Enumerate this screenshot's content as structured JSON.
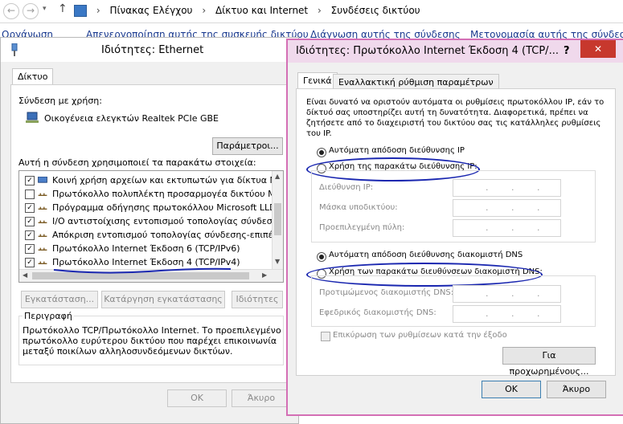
{
  "explorer": {
    "breadcrumb": [
      "Πίνακας Ελέγχου",
      "Δίκτυο και Internet",
      "Συνδέσεις δικτύου"
    ],
    "commands": [
      "Οργάνωση",
      "Απενεργοποίηση αυτής της συσκευής δικτύου",
      "Διάγνωση αυτής της σύνδεσης",
      "Μετονομασία αυτής της σύνδεσης"
    ]
  },
  "ethernet_dialog": {
    "title": "Ιδιότητες: Ethernet",
    "tab": "Δίκτυο",
    "connect_using_label": "Σύνδεση με χρήση:",
    "adapter_name": "Οικογένεια ελεγκτών Realtek PCIe GBE",
    "configure_button": "Παράμετροι...",
    "items_label": "Αυτή η σύνδεση χρησιμοποιεί τα παρακάτω στοιχεία:",
    "items": [
      {
        "label": "Κοινή χρήση αρχείων και εκτυπωτών για δίκτυα Micro",
        "checked": true
      },
      {
        "label": "Πρωτόκολλο πολυπλέκτη προσαρμογέα δικτύου Micros",
        "checked": false
      },
      {
        "label": "Πρόγραμμα οδήγησης πρωτοκόλλου Microsoft LLDP",
        "checked": true
      },
      {
        "label": "I/O αντιστοίχισης εντοπισμού τοπολογίας σύνδεσης-",
        "checked": true
      },
      {
        "label": "Απόκριση εντοπισμού τοπολογίας σύνδεσης-επιπέδου",
        "checked": true
      },
      {
        "label": "Πρωτόκολλο Internet Έκδοση 6 (TCP/IPv6)",
        "checked": true
      },
      {
        "label": "Πρωτόκολλο Internet Έκδοση 4 (TCP/IPv4)",
        "checked": true
      }
    ],
    "install_button": "Εγκατάσταση...",
    "uninstall_button": "Κατάργηση εγκατάστασης",
    "properties_button": "Ιδιότητες",
    "description_label": "Περιγραφή",
    "description_text": [
      "Πρωτόκολλο TCP/Πρωτόκολλο Internet. Το προεπιλεγμένο",
      "πρωτόκολλο ευρύτερου δικτύου που παρέχει επικοινωνία",
      "μεταξύ ποικίλων αλληλοσυνδεόμενων δικτύων."
    ],
    "ok_button": "ΟΚ",
    "cancel_button": "Άκυρο"
  },
  "ipv4_dialog": {
    "title": "Ιδιότητες: Πρωτόκολλο Internet Έκδοση 4 (TCP/...",
    "help_glyph": "?",
    "close_glyph": "✕",
    "tabs": [
      "Γενικά",
      "Εναλλακτική ρύθμιση παραμέτρων"
    ],
    "intro_text": [
      "Είναι δυνατό να οριστούν αυτόματα οι ρυθμίσεις πρωτοκόλλου IP, εάν το",
      "δίκτυό σας υποστηρίζει αυτή τη δυνατότητα. Διαφορετικά, πρέπει να",
      "ζητήσετε από το διαχειριστή του δικτύου σας τις κατάλληλες ρυθμίσεις",
      "του IP."
    ],
    "auto_ip_label": "Αυτόματη απόδοση διεύθυνσης IP",
    "manual_ip_label": "Χρήση της παρακάτω διεύθυνσης IP:",
    "ip_address_label": "Διεύθυνση IP:",
    "subnet_mask_label": "Μάσκα υποδικτύου:",
    "gateway_label": "Προεπιλεγμένη πύλη:",
    "auto_dns_label": "Αυτόματη απόδοση διεύθυνσης διακομιστή DNS",
    "manual_dns_label": "Χρήση των παρακάτω διευθύνσεων διακομιστή DNS:",
    "preferred_dns_label": "Προτιμώμενος διακομιστής DNS:",
    "alternate_dns_label": "Εφεδρικός διακομιστής DNS:",
    "validate_label": "Επικύρωση των ρυθμίσεων κατά την έξοδο",
    "advanced_button": "Για προχωρημένους...",
    "ok_button": "ΟΚ",
    "cancel_button": "Άκυρο",
    "ip_dot": "."
  },
  "colors": {
    "annotation": "#1a27b0",
    "dialog_border": "#d46fb5",
    "close_button": "#c7382d",
    "link": "#1a3a8f"
  }
}
